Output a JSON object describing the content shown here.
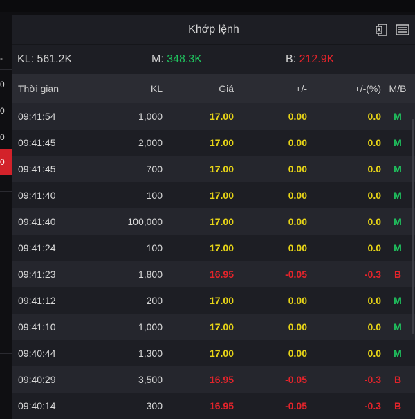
{
  "left_strip": {
    "cells": [
      "-",
      "0",
      "0",
      "0",
      "0"
    ]
  },
  "panel": {
    "title": "Khớp lệnh",
    "icons": [
      "excel-icon",
      "list-icon"
    ]
  },
  "summary": {
    "kl_label": "KL: 561.2K",
    "m_label": "M:",
    "m_value": "348.3K",
    "b_label": "B:",
    "b_value": "212.9K"
  },
  "columns": [
    "Thời gian",
    "KL",
    "Giá",
    "+/-",
    "+/-(%)",
    "M/B"
  ],
  "rows": [
    {
      "time": "09:41:54",
      "kl": "1,000",
      "price": "17.00",
      "change": "0.00",
      "pct": "0.0",
      "mb": "M",
      "tone": "yellow"
    },
    {
      "time": "09:41:45",
      "kl": "2,000",
      "price": "17.00",
      "change": "0.00",
      "pct": "0.0",
      "mb": "M",
      "tone": "yellow"
    },
    {
      "time": "09:41:45",
      "kl": "700",
      "price": "17.00",
      "change": "0.00",
      "pct": "0.0",
      "mb": "M",
      "tone": "yellow"
    },
    {
      "time": "09:41:40",
      "kl": "100",
      "price": "17.00",
      "change": "0.00",
      "pct": "0.0",
      "mb": "M",
      "tone": "yellow"
    },
    {
      "time": "09:41:40",
      "kl": "100,000",
      "price": "17.00",
      "change": "0.00",
      "pct": "0.0",
      "mb": "M",
      "tone": "yellow"
    },
    {
      "time": "09:41:24",
      "kl": "100",
      "price": "17.00",
      "change": "0.00",
      "pct": "0.0",
      "mb": "M",
      "tone": "yellow"
    },
    {
      "time": "09:41:23",
      "kl": "1,800",
      "price": "16.95",
      "change": "-0.05",
      "pct": "-0.3",
      "mb": "B",
      "tone": "red"
    },
    {
      "time": "09:41:12",
      "kl": "200",
      "price": "17.00",
      "change": "0.00",
      "pct": "0.0",
      "mb": "M",
      "tone": "yellow"
    },
    {
      "time": "09:41:10",
      "kl": "1,000",
      "price": "17.00",
      "change": "0.00",
      "pct": "0.0",
      "mb": "M",
      "tone": "yellow"
    },
    {
      "time": "09:40:44",
      "kl": "1,300",
      "price": "17.00",
      "change": "0.00",
      "pct": "0.0",
      "mb": "M",
      "tone": "yellow"
    },
    {
      "time": "09:40:29",
      "kl": "3,500",
      "price": "16.95",
      "change": "-0.05",
      "pct": "-0.3",
      "mb": "B",
      "tone": "red"
    },
    {
      "time": "09:40:14",
      "kl": "300",
      "price": "16.95",
      "change": "-0.05",
      "pct": "-0.3",
      "mb": "B",
      "tone": "red"
    }
  ],
  "colors": {
    "yellow": "#e7d417",
    "red": "#e3242b",
    "green": "#1fc35e",
    "panel_bg": "#1d1e24",
    "header_bg": "#2b2c33"
  }
}
